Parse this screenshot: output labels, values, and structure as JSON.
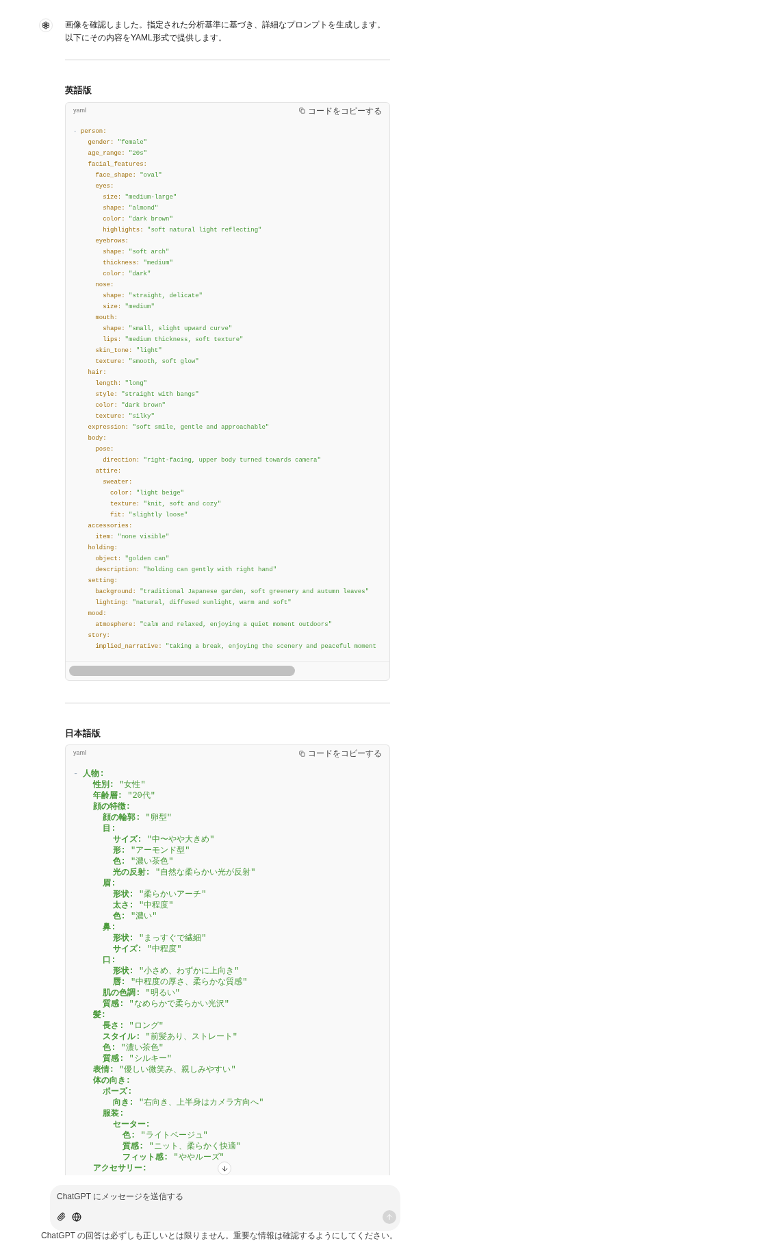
{
  "message": {
    "text": "画像を確認しました。指定された分析基準に基づき、詳細なプロンプトを生成します。以下にその内容をYAML形式で提供します。"
  },
  "sections": [
    {
      "heading": "英語版",
      "code_block": {
        "language": "yaml",
        "copy_label": "コードをコピーする",
        "keys_highlighted": true,
        "has_scrollbar": true,
        "lines": [
          {
            "marker": "-",
            "key": "person:",
            "children": [
              {
                "key": "gender:",
                "value": "\"female\""
              },
              {
                "key": "age_range:",
                "value": "\"20s\""
              },
              {
                "key": "facial_features:",
                "children": [
                  {
                    "key": "face_shape:",
                    "value": "\"oval\""
                  },
                  {
                    "key": "eyes:",
                    "children": [
                      {
                        "key": "size:",
                        "value": "\"medium-large\""
                      },
                      {
                        "key": "shape:",
                        "value": "\"almond\""
                      },
                      {
                        "key": "color:",
                        "value": "\"dark brown\""
                      },
                      {
                        "key": "highlights:",
                        "value": "\"soft natural light reflecting\""
                      }
                    ]
                  },
                  {
                    "key": "eyebrows:",
                    "children": [
                      {
                        "key": "shape:",
                        "value": "\"soft arch\""
                      },
                      {
                        "key": "thickness:",
                        "value": "\"medium\""
                      },
                      {
                        "key": "color:",
                        "value": "\"dark\""
                      }
                    ]
                  },
                  {
                    "key": "nose:",
                    "children": [
                      {
                        "key": "shape:",
                        "value": "\"straight, delicate\""
                      },
                      {
                        "key": "size:",
                        "value": "\"medium\""
                      }
                    ]
                  },
                  {
                    "key": "mouth:",
                    "children": [
                      {
                        "key": "shape:",
                        "value": "\"small, slight upward curve\""
                      },
                      {
                        "key": "lips:",
                        "value": "\"medium thickness, soft texture\""
                      }
                    ]
                  },
                  {
                    "key": "skin_tone:",
                    "value": "\"light\""
                  },
                  {
                    "key": "texture:",
                    "value": "\"smooth, soft glow\""
                  }
                ]
              },
              {
                "key": "hair:",
                "children": [
                  {
                    "key": "length:",
                    "value": "\"long\""
                  },
                  {
                    "key": "style:",
                    "value": "\"straight with bangs\""
                  },
                  {
                    "key": "color:",
                    "value": "\"dark brown\""
                  },
                  {
                    "key": "texture:",
                    "value": "\"silky\""
                  }
                ]
              },
              {
                "key": "expression:",
                "value": "\"soft smile, gentle and approachable\""
              },
              {
                "key": "body:",
                "children": [
                  {
                    "key": "pose:",
                    "children": [
                      {
                        "key": "direction:",
                        "value": "\"right-facing, upper body turned towards camera\""
                      }
                    ]
                  },
                  {
                    "key": "attire:",
                    "children": [
                      {
                        "key": "sweater:",
                        "children": [
                          {
                            "key": "color:",
                            "value": "\"light beige\""
                          },
                          {
                            "key": "texture:",
                            "value": "\"knit, soft and cozy\""
                          },
                          {
                            "key": "fit:",
                            "value": "\"slightly loose\""
                          }
                        ]
                      }
                    ]
                  }
                ]
              },
              {
                "key": "accessories:",
                "children": [
                  {
                    "key": "item:",
                    "value": "\"none visible\""
                  }
                ]
              },
              {
                "key": "holding:",
                "children": [
                  {
                    "key": "object:",
                    "value": "\"golden can\""
                  },
                  {
                    "key": "description:",
                    "value": "\"holding can gently with right hand\""
                  }
                ]
              },
              {
                "key": "setting:",
                "children": [
                  {
                    "key": "background:",
                    "value": "\"traditional Japanese garden, soft greenery and autumn leaves\""
                  },
                  {
                    "key": "lighting:",
                    "value": "\"natural, diffused sunlight, warm and soft\""
                  }
                ]
              },
              {
                "key": "mood:",
                "children": [
                  {
                    "key": "atmosphere:",
                    "value": "\"calm and relaxed, enjoying a quiet moment outdoors\""
                  }
                ]
              },
              {
                "key": "story:",
                "children": [
                  {
                    "key": "implied_narrative:",
                    "value": "\"taking a break, enjoying the scenery and peaceful moment"
                  }
                ]
              }
            ]
          }
        ]
      }
    },
    {
      "heading": "日本語版",
      "code_block": {
        "language": "yaml",
        "copy_label": "コードをコピーする",
        "keys_highlighted": false,
        "has_scrollbar": false,
        "lines": [
          {
            "marker": "-",
            "key": "人物:",
            "children": [
              {
                "key": "性別:",
                "value": "\"女性\""
              },
              {
                "key": "年齢層:",
                "value": "\"20代\""
              },
              {
                "key": "顔の特徴:",
                "children": [
                  {
                    "key": "顔の輪郭:",
                    "value": "\"卵型\""
                  },
                  {
                    "key": "目:",
                    "children": [
                      {
                        "key": "サイズ:",
                        "value": "\"中〜やや大きめ\""
                      },
                      {
                        "key": "形:",
                        "value": "\"アーモンド型\""
                      },
                      {
                        "key": "色:",
                        "value": "\"濃い茶色\""
                      },
                      {
                        "key": "光の反射:",
                        "value": "\"自然な柔らかい光が反射\""
                      }
                    ]
                  },
                  {
                    "key": "眉:",
                    "children": [
                      {
                        "key": "形状:",
                        "value": "\"柔らかいアーチ\""
                      },
                      {
                        "key": "太さ:",
                        "value": "\"中程度\""
                      },
                      {
                        "key": "色:",
                        "value": "\"濃い\""
                      }
                    ]
                  },
                  {
                    "key": "鼻:",
                    "children": [
                      {
                        "key": "形状:",
                        "value": "\"まっすぐで繊細\""
                      },
                      {
                        "key": "サイズ:",
                        "value": "\"中程度\""
                      }
                    ]
                  },
                  {
                    "key": "口:",
                    "children": [
                      {
                        "key": "形状:",
                        "value": "\"小さめ、わずかに上向き\""
                      },
                      {
                        "key": "唇:",
                        "value": "\"中程度の厚さ、柔らかな質感\""
                      }
                    ]
                  },
                  {
                    "key": "肌の色調:",
                    "value": "\"明るい\""
                  },
                  {
                    "key": "質感:",
                    "value": "\"なめらかで柔らかい光沢\""
                  }
                ]
              },
              {
                "key": "髪:",
                "children": [
                  {
                    "key": "長さ:",
                    "value": "\"ロング\""
                  },
                  {
                    "key": "スタイル:",
                    "value": "\"前髪あり、ストレート\""
                  },
                  {
                    "key": "色:",
                    "value": "\"濃い茶色\""
                  },
                  {
                    "key": "質感:",
                    "value": "\"シルキー\""
                  }
                ]
              },
              {
                "key": "表情:",
                "value": "\"優しい微笑み、親しみやすい\""
              },
              {
                "key": "体の向き:",
                "children": [
                  {
                    "key": "ポーズ:",
                    "children": [
                      {
                        "key": "向き:",
                        "value": "\"右向き、上半身はカメラ方向へ\""
                      }
                    ]
                  },
                  {
                    "key": "服装:",
                    "children": [
                      {
                        "key": "セーター:",
                        "children": [
                          {
                            "key": "色:",
                            "value": "\"ライトベージュ\""
                          },
                          {
                            "key": "質感:",
                            "value": "\"ニット、柔らかく快適\""
                          },
                          {
                            "key": "フィット感:",
                            "value": "\"ややルーズ\""
                          }
                        ]
                      }
                    ]
                  }
                ]
              },
              {
                "key": "アクセサリー:"
              }
            ]
          }
        ]
      }
    }
  ],
  "composer": {
    "placeholder": "ChatGPT にメッセージを送信する",
    "send_disabled": true
  },
  "disclaimer": "ChatGPT の回答は必ずしも正しいとは限りません。重要な情報は確認するようにしてください。"
}
